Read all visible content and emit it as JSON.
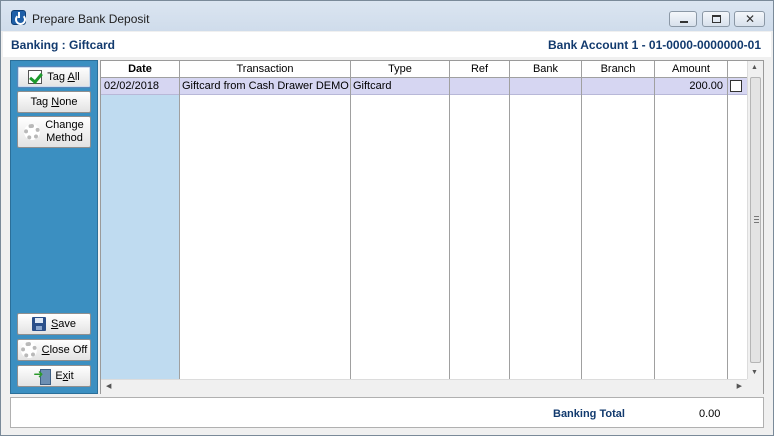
{
  "window": {
    "title": "Prepare Bank Deposit"
  },
  "header": {
    "left": "Banking : Giftcard",
    "right": "Bank Account 1 - 01-0000-0000000-01"
  },
  "side_buttons": {
    "tag_all": {
      "pre": "Tag ",
      "u": "A",
      "post": "ll"
    },
    "tag_none": {
      "pre": "Tag ",
      "u": "N",
      "post": "one"
    },
    "change_method": {
      "line1": "Change",
      "line2": "Method"
    },
    "save": {
      "u": "S",
      "post": "ave"
    },
    "close_off": {
      "u": "C",
      "post": "lose Off"
    },
    "exit": {
      "pre": "E",
      "u": "x",
      "post": "it"
    }
  },
  "table": {
    "headers": [
      "Date",
      "Transaction",
      "Type",
      "Ref",
      "Bank",
      "Branch",
      "Amount"
    ],
    "rows": [
      {
        "date": "02/02/2018",
        "transaction": "Giftcard from Cash Drawer DEMO",
        "type": "Giftcard",
        "ref": "",
        "bank": "",
        "branch": "",
        "amount": "200.00",
        "tagged": false
      }
    ]
  },
  "footer": {
    "total_label": "Banking Total",
    "total_value": "0.00"
  }
}
